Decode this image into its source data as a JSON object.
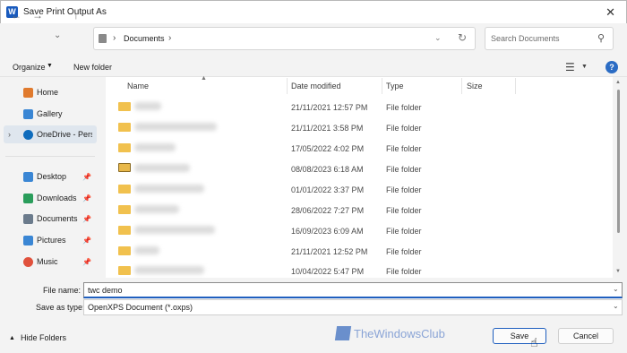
{
  "window": {
    "title": "Save Print Output As",
    "app_icon": "W"
  },
  "nav": {
    "back": "←",
    "forward": "→",
    "recent": "⌄",
    "up": "↑",
    "path": "Documents",
    "search_placeholder": "Search Documents"
  },
  "toolbar": {
    "organize": "Organize",
    "new_folder": "New folder",
    "help": "?"
  },
  "sidebar": {
    "items": [
      {
        "label": "Home",
        "icon": "home-icon",
        "color": "#e07a2d"
      },
      {
        "label": "Gallery",
        "icon": "gallery-icon",
        "color": "#3a86d4"
      },
      {
        "label": "OneDrive - Perso",
        "icon": "onedrive-icon",
        "color": "#0f6cbd"
      },
      {
        "label": "Desktop",
        "icon": "desktop-icon",
        "color": "#3a86d4"
      },
      {
        "label": "Downloads",
        "icon": "downloads-icon",
        "color": "#2a9d5b"
      },
      {
        "label": "Documents",
        "icon": "documents-icon",
        "color": "#6b7b8c"
      },
      {
        "label": "Pictures",
        "icon": "pictures-icon",
        "color": "#3a86d4"
      },
      {
        "label": "Music",
        "icon": "music-icon",
        "color": "#e0513c"
      }
    ]
  },
  "columns": {
    "name": "Name",
    "date": "Date modified",
    "type": "Type",
    "size": "Size"
  },
  "files": [
    {
      "date": "21/11/2021 12:57 PM",
      "type": "File folder"
    },
    {
      "date": "21/11/2021 3:58 PM",
      "type": "File folder"
    },
    {
      "date": "17/05/2022 4:02 PM",
      "type": "File folder"
    },
    {
      "date": "08/08/2023 6:18 AM",
      "type": "File folder"
    },
    {
      "date": "01/01/2022 3:37 PM",
      "type": "File folder"
    },
    {
      "date": "28/06/2022 7:27 PM",
      "type": "File folder"
    },
    {
      "date": "16/09/2023 6:09 AM",
      "type": "File folder"
    },
    {
      "date": "21/11/2021 12:52 PM",
      "type": "File folder"
    },
    {
      "date": "10/04/2022 5:47 PM",
      "type": "File folder"
    }
  ],
  "form": {
    "file_name_label": "File name:",
    "file_name_value": "twc demo",
    "save_as_type_label": "Save as type:",
    "save_as_type_value": "OpenXPS Document (*.oxps)"
  },
  "footer": {
    "hide_folders": "Hide Folders",
    "save": "Save",
    "cancel": "Cancel",
    "watermark": "TheWindowsClub"
  },
  "colors": {
    "accent": "#1f5fbf",
    "folder": "#f1c14e"
  }
}
